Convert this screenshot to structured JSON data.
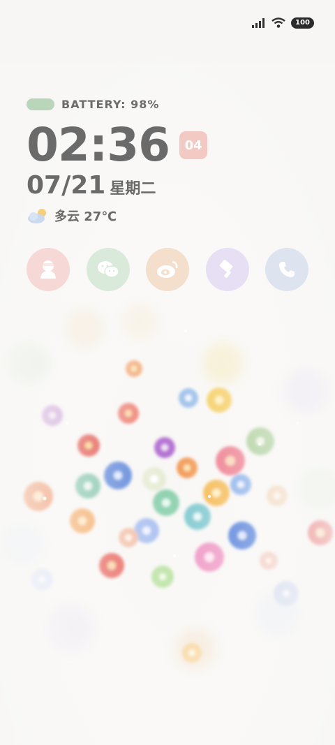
{
  "status_bar": {
    "battery_level": "100",
    "icons": [
      "signal-icon",
      "wifi-icon",
      "battery-icon"
    ]
  },
  "widget": {
    "battery_label": "BATTERY: 98%",
    "time": "02:36",
    "seconds": "04",
    "date": "07/21",
    "weekday": "星期二",
    "weather": "多云 27℃"
  },
  "apps": [
    {
      "name": "avatar-app-icon",
      "color": "#f6d9d6"
    },
    {
      "name": "chat-app-icon",
      "color": "#d9eadb"
    },
    {
      "name": "weibo-app-icon",
      "color": "#f4dfcc"
    },
    {
      "name": "brush-app-icon",
      "color": "#e7dff3"
    },
    {
      "name": "phone-app-icon",
      "color": "#dde4f0"
    }
  ],
  "colors": {
    "text": "#6a6a6a",
    "battery_bar": "#b9d6bb",
    "seconds_badge": "#f3c9c4"
  }
}
